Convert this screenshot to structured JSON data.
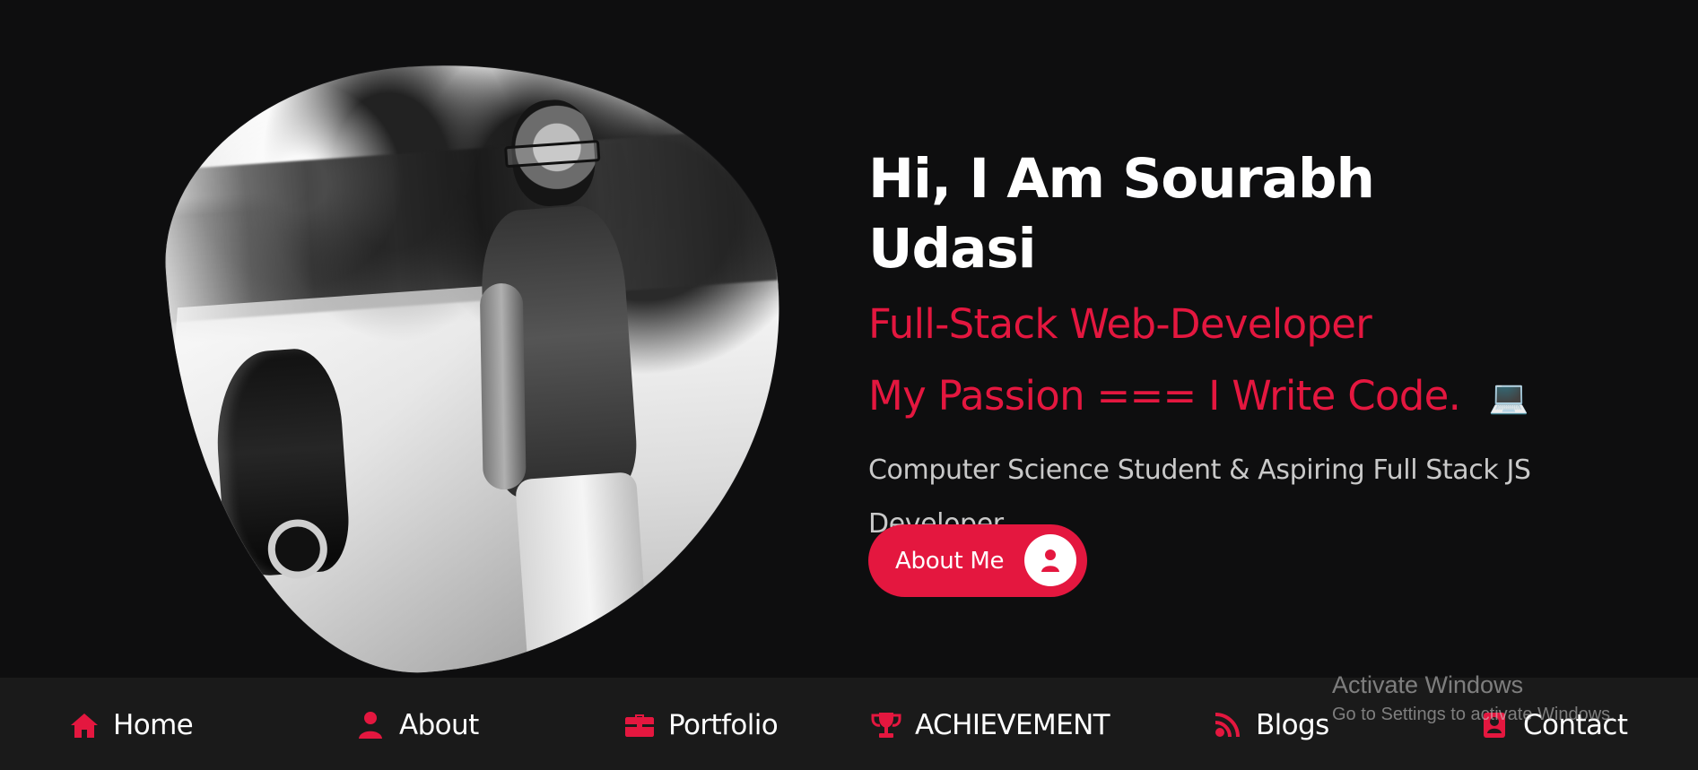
{
  "hero": {
    "greeting": "Hi, I Am Sourabh Udasi",
    "role": "Full-Stack Web-Developer",
    "passion": "My Passion === I Write Code.",
    "laptop_icon": "💻",
    "description": "Computer Science Student & Aspiring Full Stack JS Developer",
    "button_label": "About Me"
  },
  "navigation": {
    "items": [
      {
        "label": "Home",
        "icon": "home-icon"
      },
      {
        "label": "About",
        "icon": "user-icon"
      },
      {
        "label": "Portfolio",
        "icon": "briefcase-icon"
      },
      {
        "label": "ACHIEVEMENT",
        "icon": "trophy-icon"
      },
      {
        "label": "Blogs",
        "icon": "blog-icon"
      },
      {
        "label": "Contact",
        "icon": "contact-icon"
      }
    ]
  },
  "windows_watermark": {
    "title": "Activate Windows",
    "subtitle": "Go to Settings to activate Windows."
  },
  "colors": {
    "background": "#0e0e0f",
    "nav_background": "#1a1a1a",
    "accent": "#e4173f",
    "text": "#ffffff",
    "muted_text": "#c9c9c9"
  }
}
